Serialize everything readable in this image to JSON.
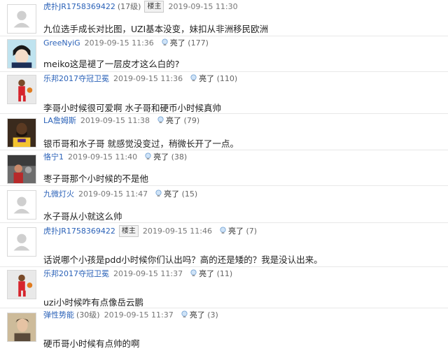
{
  "labels": {
    "light": "亮了",
    "host_badge": "楼主"
  },
  "posts": [
    {
      "user": "虎扑JR1758369422",
      "level": "(17级)",
      "badge": "楼主",
      "time": "2019-09-15 11:30",
      "light_count": "",
      "content": "九位选手成长对比图，UZI基本没变，妹扣从非洲移民欧洲"
    },
    {
      "user": "GreeNyiG",
      "level": "",
      "badge": "",
      "time": "2019-09-15 11:36",
      "light_count": "(177)",
      "content": "meiko这是褪了一层皮才这么白的?"
    },
    {
      "user": "乐邦2017夺冠卫冕",
      "level": "",
      "badge": "",
      "time": "2019-09-15 11:36",
      "light_count": "(110)",
      "content": "李哥小时候很可爱啊 水子哥和硬币小时候真帅"
    },
    {
      "user": "LA詹姆斯",
      "level": "",
      "badge": "",
      "time": "2019-09-15 11:38",
      "light_count": "(79)",
      "content": "银币哥和水子哥 就感觉没变过，稍微长开了一点。"
    },
    {
      "user": "恪宁1",
      "level": "",
      "badge": "",
      "time": "2019-09-15 11:40",
      "light_count": "(38)",
      "content": "枣子哥那个小时候的不是他"
    },
    {
      "user": "九微灯火",
      "level": "",
      "badge": "",
      "time": "2019-09-15 11:47",
      "light_count": "(15)",
      "content": "水子哥从小就这么帅"
    },
    {
      "user": "虎扑JR1758369422",
      "level": "",
      "badge": "楼主",
      "time": "2019-09-15 11:46",
      "light_count": "(7)",
      "content": "话说哪个小孩是pdd小时候你们认出吗？高的还是矮的？我是没认出来。"
    },
    {
      "user": "乐邦2017夺冠卫冕",
      "level": "",
      "badge": "",
      "time": "2019-09-15 11:37",
      "light_count": "(11)",
      "content": "uzi小时候咋有点像岳云鹏"
    },
    {
      "user": "弹性势能",
      "level": "(30级)",
      "badge": "",
      "time": "2019-09-15 11:37",
      "light_count": "(3)",
      "content": "硬币哥小时候有点帅的啊"
    }
  ]
}
